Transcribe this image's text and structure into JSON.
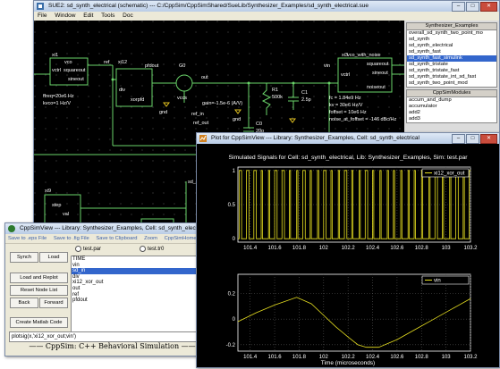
{
  "sue": {
    "title": "SUE2: sd_synth_electrical (schematic) --- C:/CppSim/CppSimShared/SueLib/Synthesizer_Examples/sd_synth_electrical.sue",
    "menu": [
      "File",
      "Window",
      "Edit",
      "Tools",
      "Doc"
    ],
    "library_header": "Synthesizer_Examples",
    "library_items": [
      "overall_sd_synth_two_point_mo",
      "sd_synth",
      "sd_synth_electrical",
      "sd_synth_fast",
      "sd_synth_fast_simulink",
      "sd_synth_tristate",
      "sd_synth_tristate_fast",
      "sd_synth_tristate_int_sd_fast",
      "sd_synth_two_point_mod"
    ],
    "library_selected_index": 4,
    "modules_header": "CppSimModules",
    "modules_items": [
      "accum_and_dump",
      "accumulator",
      "add2",
      "add3"
    ],
    "schematic_labels": {
      "xi1": "xi1",
      "vco": "vco",
      "squareout": "squareout",
      "sineout": "sineout",
      "vctrl": "vctrl",
      "freq": "ffreq=20e6 Hz",
      "kvco": "kvco=1 Hz/V",
      "ref": "ref",
      "xi12": "xi12",
      "div": "div",
      "xorpfd": "xorpfd",
      "pfdout": "pfdout",
      "g0": "G0",
      "vccs": "vccs",
      "gain": "gain=-1.5e-6 (A/V)",
      "ref_in": "ref_in",
      "ref_out": "ref_out",
      "gnd1": "gnd",
      "gnd2": "gnd",
      "out": "out",
      "r1": "R1",
      "r1v": "500k",
      "c0": "C0",
      "c0v": "20p",
      "c1": "C1",
      "c1v": "2.5p",
      "vin": "vin",
      "xi3": "xi3",
      "vco_noise": "vco_with_noise",
      "sqo": "squareout",
      "sino": "sineout",
      "noiseout": "noiseout",
      "vctrl2": "vctrl",
      "fc": "fc = 1.84e9 Hz",
      "kv": "kv = 30e6 Hz/V",
      "foffset": "foffset = 10e6 Hz",
      "noise": "noise_at_foffset = -146 dBc/Hz",
      "xi9": "xi9",
      "sd_in": "sd_in",
      "step": "step",
      "val": "val"
    }
  },
  "cppsimview": {
    "title": "CppSimView --- Library: Synthesizer_Examples, Cell: sd_synth_electrical",
    "menu": [
      "Save to .eps File",
      "Save to .fig File",
      "Save to Clipboard",
      "Zoom",
      "CppSimHome:"
    ],
    "radio_left": "test.par",
    "radio_right": "test.tr0",
    "buttons": {
      "synch": "Synch",
      "load": "Load",
      "load_replot": "Load and Replot",
      "reset": "Reset Node List",
      "back": "Back",
      "forward": "Forward",
      "matlab": "Create Matlab Code"
    },
    "nodes": [
      "TIME",
      "vin",
      "sd_in",
      "div",
      "xi12_xor_out",
      "out",
      "ref",
      "pfdout"
    ],
    "selected_node_index": 2,
    "command": "plotsig(x,'xi12_xor_out;vin')",
    "footer": "CppSim:  C++ Behavioral Simulation"
  },
  "plot": {
    "title": "Plot for CppSimView --- Library: Synthesizer_Examples, Cell: sd_synth_electrical",
    "chart_title": "Simulated Signals for Cell: sd_synth_electrical, Lib: Synthesizer_Examples, Sim: test.par"
  },
  "chart_data": [
    {
      "type": "line",
      "title": "Simulated Signals for Cell: sd_synth_electrical, Lib: Synthesizer_Examples, Sim: test.par",
      "series": [
        {
          "name": "xi12_xor_out"
        }
      ],
      "xlim": [
        101.3,
        103.2
      ],
      "ylim": [
        -0.05,
        1.05
      ],
      "xticks": [
        "101.4",
        "101.6",
        "101.8",
        "102",
        "102.2",
        "102.4",
        "102.6",
        "102.8",
        "103",
        "103.2"
      ],
      "yticks": [
        "0",
        "0.5",
        "1"
      ],
      "edges": [
        101.31,
        101.33,
        101.37,
        101.39,
        101.43,
        101.45,
        101.49,
        101.5,
        101.55,
        101.56,
        101.6,
        101.62,
        101.66,
        101.68,
        101.72,
        101.73,
        101.78,
        101.79,
        101.83,
        101.85,
        101.89,
        101.9,
        101.95,
        101.96,
        102.0,
        102.02,
        102.06,
        102.07,
        102.12,
        102.13,
        102.17,
        102.19,
        102.23,
        102.24,
        102.29,
        102.3,
        102.34,
        102.36,
        102.4,
        102.41,
        102.46,
        102.47,
        102.52,
        102.53,
        102.57,
        102.58,
        102.63,
        102.64,
        102.69,
        102.7,
        102.74,
        102.75,
        102.8,
        102.81,
        102.86,
        102.87,
        102.91,
        102.93,
        102.97,
        102.98,
        103.03,
        103.04,
        103.08,
        103.1,
        103.14,
        103.15,
        103.19
      ]
    },
    {
      "type": "line",
      "series": [
        {
          "name": "vin",
          "color": "#e8e020"
        }
      ],
      "xlabel": "Time (microseconds)",
      "xlim": [
        101.3,
        103.2
      ],
      "ylim": [
        -0.25,
        0.35
      ],
      "xticks": [
        "101.4",
        "101.6",
        "101.8",
        "102",
        "102.2",
        "102.4",
        "102.6",
        "102.8",
        "103",
        "103.2"
      ],
      "yticks": [
        "-0.2",
        "0",
        "0.2"
      ],
      "x": [
        101.3,
        101.45,
        101.6,
        101.78,
        101.9,
        102.0,
        102.1,
        102.2,
        102.28,
        102.35,
        102.45,
        102.6,
        102.75,
        102.9,
        103.05,
        103.2
      ],
      "y": [
        -0.02,
        0.05,
        0.11,
        0.17,
        0.12,
        0.03,
        -0.06,
        -0.14,
        -0.2,
        -0.22,
        -0.22,
        -0.16,
        -0.08,
        0.0,
        0.08,
        0.16
      ]
    }
  ]
}
